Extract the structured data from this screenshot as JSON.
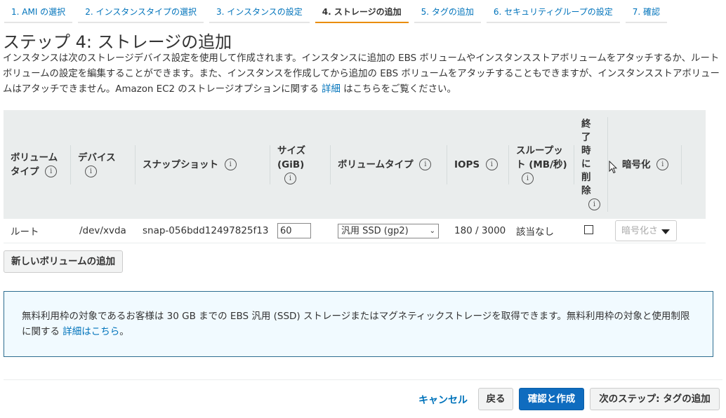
{
  "steps": [
    {
      "label": "1. AMI の選択"
    },
    {
      "label": "2. インスタンスタイプの選択"
    },
    {
      "label": "3. インスタンスの設定"
    },
    {
      "label": "4. ストレージの追加"
    },
    {
      "label": "5. タグの追加"
    },
    {
      "label": "6. セキュリティグループの設定"
    },
    {
      "label": "7. 確認"
    }
  ],
  "active_step": 3,
  "page_title": "ステップ 4: ストレージの追加",
  "description": {
    "text": "インスタンスは次のストレージデバイス設定を使用して作成されます。インスタンスに追加の EBS ボリュームやインスタンスストアボリュームをアタッチするか、ルートボリュームの設定を編集することができます。また、インスタンスを作成してから追加の EBS ボリュームをアタッチすることもできますが、インスタンスストアボリュームはアタッチできません。Amazon EC2 のストレージオプションに関する",
    "link": "詳細",
    "suffix": "はこちらをご覧ください。"
  },
  "table": {
    "headers": {
      "volume_type": "ボリュームタイプ",
      "device": "デバイス",
      "snapshot": "スナップショット",
      "size": "サイズ (GiB)",
      "ebs_type": "ボリュームタイプ",
      "iops": "IOPS",
      "throughput": "スループット (MB/秒)",
      "delete_on_term": "終了時に削除",
      "encryption": "暗号化"
    },
    "row": {
      "volume_type": "ルート",
      "device": "/dev/xvda",
      "snapshot": "snap-056bdd12497825f13",
      "size": "60",
      "ebs_type": "汎用 SSD (gp2)",
      "iops": "180 / 3000",
      "throughput": "該当なし",
      "delete_on_term": false,
      "encryption": "暗号化され"
    }
  },
  "info_glyph": "i",
  "add_volume_button": "新しいボリュームの追加",
  "notice": {
    "text": "無料利用枠の対象であるお客様は 30 GB までの EBS 汎用 (SSD) ストレージまたはマグネティックストレージを取得できます。無料利用枠の対象と使用制限に関する",
    "link": "詳細はこちら",
    "suffix": "。"
  },
  "footer": {
    "cancel": "キャンセル",
    "back": "戻る",
    "review": "確認と作成",
    "next": "次のステップ: タグの追加"
  },
  "colors": {
    "link": "#0073bb",
    "active_step_underline": "#e98d00",
    "primary_button": "#0f6cbf",
    "header_bg": "#eaeded",
    "notice_border": "#2e6e91",
    "notice_bg": "#f1faff"
  }
}
